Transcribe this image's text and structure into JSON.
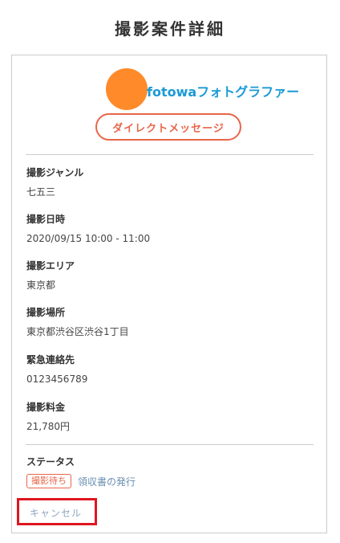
{
  "page": {
    "title": "撮影案件詳細"
  },
  "photographer": {
    "name": "fotowaフォトグラファー",
    "avatar_color": "#ff8a2a"
  },
  "actions": {
    "dm_label": "ダイレクトメッセージ"
  },
  "details": [
    {
      "label": "撮影ジャンル",
      "value": "七五三"
    },
    {
      "label": "撮影日時",
      "value": "2020/09/15 10:00 - 11:00"
    },
    {
      "label": "撮影エリア",
      "value": "東京都"
    },
    {
      "label": "撮影場所",
      "value": "東京都渋谷区渋谷1丁目"
    },
    {
      "label": "緊急連絡先",
      "value": "0123456789"
    },
    {
      "label": "撮影料金",
      "value": "21,780円"
    }
  ],
  "status": {
    "label": "ステータス",
    "badge": "撮影待ち",
    "receipt_link": "領収書の発行",
    "cancel_link": "キャンセル"
  },
  "colors": {
    "accent": "#e8664a",
    "link": "#1a9ad6",
    "highlight_box": "#e0161f"
  }
}
